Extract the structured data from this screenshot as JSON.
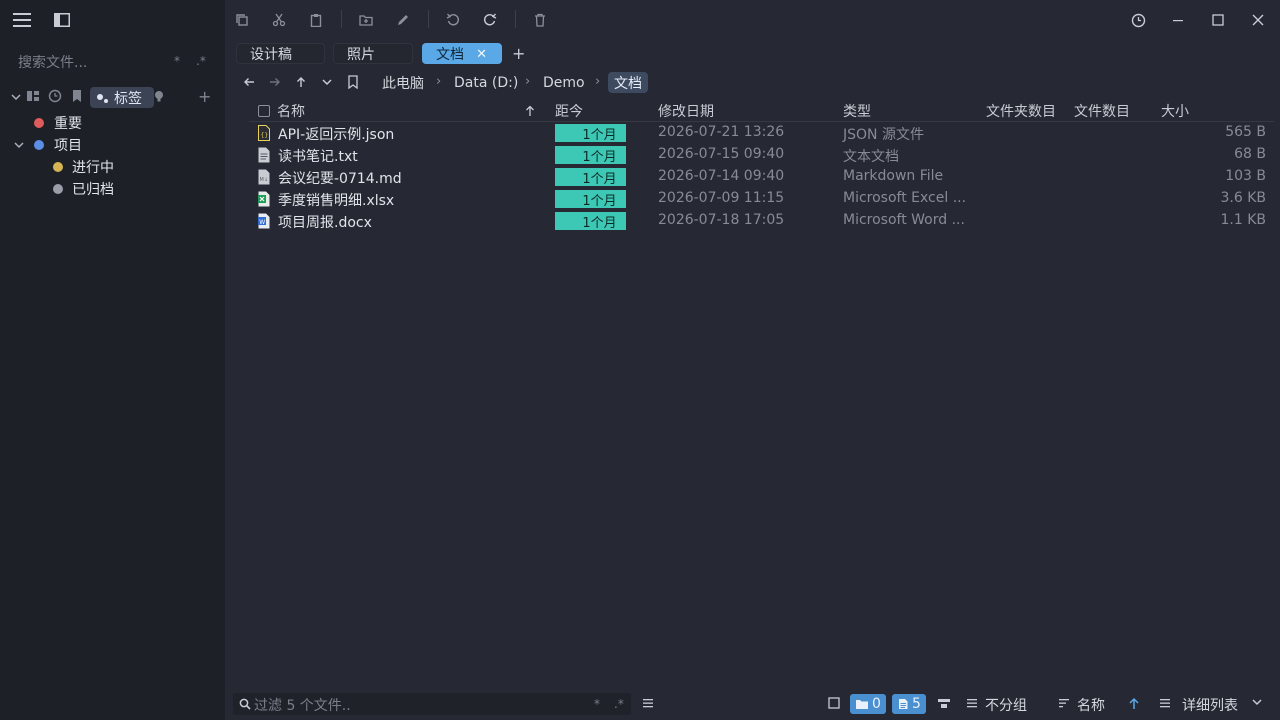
{
  "sidebar": {
    "search_placeholder": "搜索文件...",
    "opt_glob": "*",
    "opt_regex": ".*",
    "tag_label": "标签",
    "add": "+",
    "tree": [
      {
        "label": "重要",
        "color": "#e05c5c"
      },
      {
        "label": "项目",
        "color": "#5b8ee6"
      },
      {
        "label": "进行中",
        "color": "#d6b454"
      },
      {
        "label": "已归档",
        "color": "#9a9ea8"
      }
    ]
  },
  "tabs": [
    {
      "label": "设计稿"
    },
    {
      "label": "照片"
    },
    {
      "label": "文档",
      "close": "✕"
    }
  ],
  "tab_add": "+",
  "breadcrumb": [
    "此电脑",
    "Data (D:)",
    "Demo",
    "文档"
  ],
  "breadcrumb_sep": "›",
  "columns": {
    "name": "名称",
    "age": "距今",
    "modified": "修改日期",
    "type": "类型",
    "folder_count": "文件夹数目",
    "file_count": "文件数目",
    "size": "大小"
  },
  "files": [
    {
      "name": "API-返回示例.json",
      "age": "1个月",
      "modified": "2026-07-21 13:26",
      "type": "JSON 源文件",
      "size": "565 B",
      "icon": "json-file-icon",
      "icon_color": "#e8d25a"
    },
    {
      "name": "读书笔记.txt",
      "age": "1个月",
      "modified": "2026-07-15 09:40",
      "type": "文本文档",
      "size": "68 B",
      "icon": "text-file-icon",
      "icon_color": "#c9ccd3"
    },
    {
      "name": "会议纪要-0714.md",
      "age": "1个月",
      "modified": "2026-07-14 09:40",
      "type": "Markdown File",
      "size": "103 B",
      "icon": "markdown-file-icon",
      "icon_color": "#c9ccd3"
    },
    {
      "name": "季度销售明细.xlsx",
      "age": "1个月",
      "modified": "2026-07-09 11:15",
      "type": "Microsoft Excel ...",
      "size": "3.6 KB",
      "icon": "excel-file-icon",
      "icon_color": "#1f9d55"
    },
    {
      "name": "项目周报.docx",
      "age": "1个月",
      "modified": "2026-07-18 17:05",
      "type": "Microsoft Word ...",
      "size": "1.1 KB",
      "icon": "word-file-icon",
      "icon_color": "#2f6fd1"
    }
  ],
  "status": {
    "filter_placeholder": "过滤 5 个文件..",
    "opt_glob": "*",
    "opt_regex": ".*",
    "folder_count": "0",
    "file_count": "5",
    "group": "不分组",
    "sort": "名称",
    "view": "详细列表"
  },
  "colors": {
    "accent": "#5aa9e6",
    "age_badge": "#3cc8b4",
    "background": "#262933",
    "sidebar": "#1d2027"
  }
}
